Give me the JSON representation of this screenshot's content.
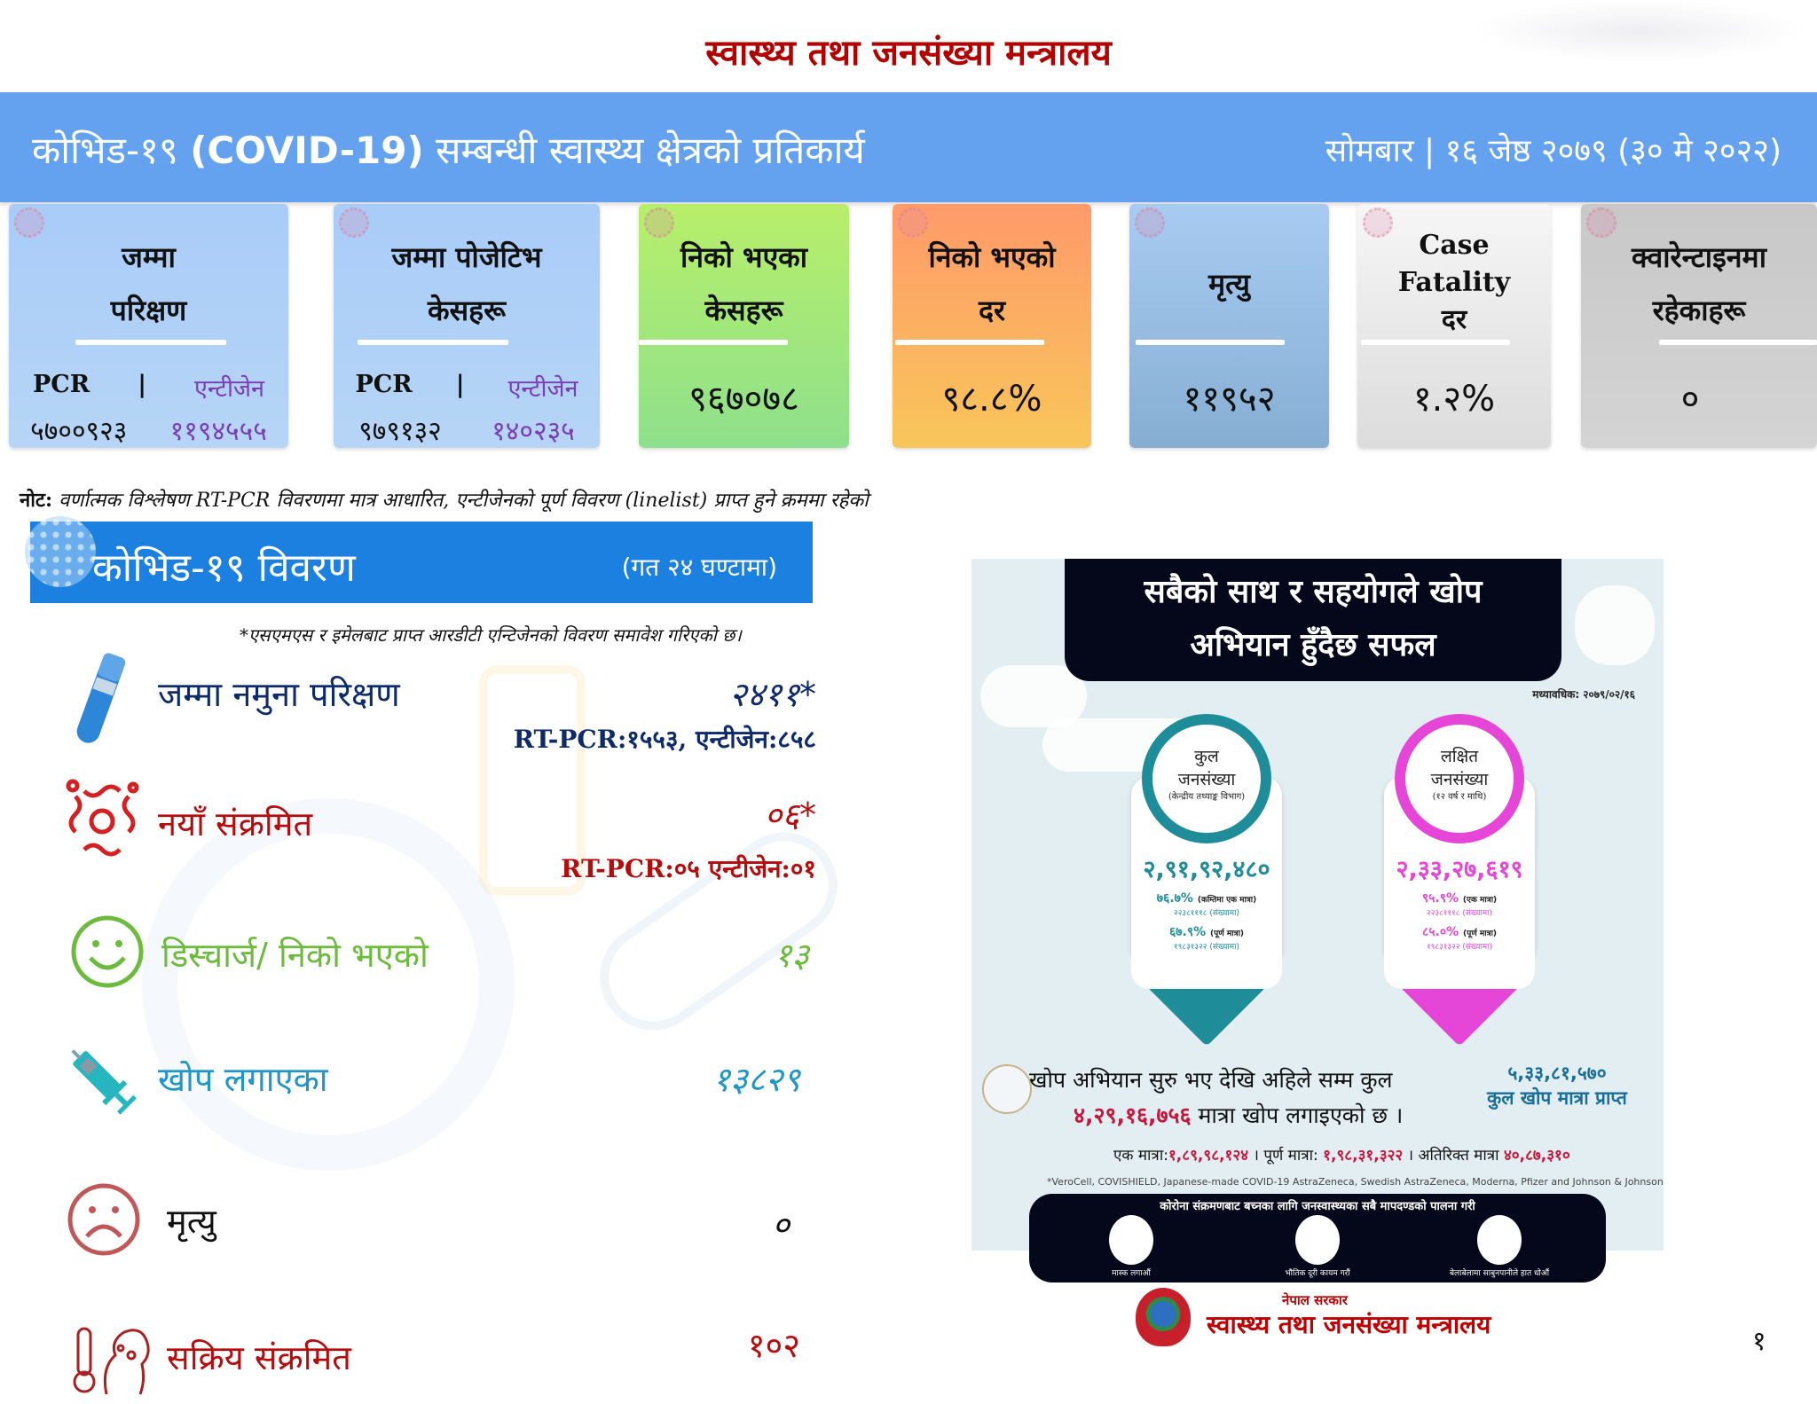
{
  "ministry_title": "स्वास्थ्य तथा जनसंख्या मन्त्रालय",
  "header": {
    "title_prefix": "कोभिड-१९",
    "title_english": "(COVID-19)",
    "title_suffix": "सम्बन्धी स्वास्थ्य क्षेत्रको प्रतिकार्य",
    "date": "सोमबार | १६ जेष्ठ २०७९ (३० मे २०२२)"
  },
  "cards": [
    {
      "title_line1": "जम्मा",
      "title_line2": "परिक्षण",
      "pcr_label": "PCR",
      "separator": "|",
      "antigen_label": "एन्टीजेन",
      "pcr_value": "५७००९२३",
      "antigen_value": "११९४५५५",
      "color_top": "#a9ccf8",
      "color_bottom": "#b6d5f6"
    },
    {
      "title_line1": "जम्मा पोजेटिभ",
      "title_line2": "केसहरू",
      "pcr_label": "PCR",
      "separator": "|",
      "antigen_label": "एन्टीजेन",
      "pcr_value": "९७९१३२",
      "antigen_value": "१४०२३५",
      "color_top": "#a9ccf8",
      "color_bottom": "#b6d5f6"
    },
    {
      "title_line1": "निको भएका",
      "title_line2": "केसहरू",
      "value": "९६७०७८",
      "color_top": "#b8ef6a",
      "color_bottom": "#8ee08c"
    },
    {
      "title_line1": "निको भएको",
      "title_line2": "दर",
      "value": "९८.८%",
      "color_top": "#ff9a6a",
      "color_bottom": "#f8c65a"
    },
    {
      "title_line1": "मृत्यु",
      "title_line2": "",
      "value": "११९५२",
      "color_top": "#a8cbf2",
      "color_bottom": "#86aed2"
    },
    {
      "title_line1": "Case",
      "title_line2": "Fatality",
      "title_line3": "दर",
      "value": "१.२%",
      "color_top": "#f6f6f6",
      "color_bottom": "#dcdcdc"
    },
    {
      "title_line1": "क्वारेन्टाइनमा",
      "title_line2": "रहेकाहरू",
      "value": "०",
      "color_top": "#c8c8c8",
      "color_bottom": "#d4d4d4"
    }
  ],
  "note": {
    "label": "नोट:",
    "text": "वर्णात्मक विश्लेषण RT-PCR  विवरणमा मात्र आधारित, एन्टीजेनको पूर्ण विवरण (linelist) प्राप्त हुने क्रममा रहेको"
  },
  "details": {
    "title": "कोभिड-१९ विवरण",
    "subtitle": "(गत २४ घण्टामा)",
    "footnote": "*एसएमएस र इमेलबाट प्राप्त आरडीटी एन्टिजेनको विवरण समावेश गरिएको छ।",
    "rows": [
      {
        "icon": "test-tube-icon",
        "label": "जम्मा नमुना परिक्षण",
        "value": "२४११*",
        "detail": "RT-PCR:१५५३, एन्टीजेन:८५८",
        "color": "#0d2a6b",
        "icon_color": "#2d86d8"
      },
      {
        "icon": "virus-icon",
        "label": "नयाँ संक्रमित",
        "value": "०६*",
        "detail": "RT-PCR:०५ एन्टीजेन:०१",
        "color": "#b50d0d",
        "icon_color": "#d42020"
      },
      {
        "icon": "smiley-icon",
        "label": "डिस्चार्ज/ निको भएको",
        "value": "१३",
        "color": "#6dbb3c",
        "icon_color": "#6dbb3c"
      },
      {
        "icon": "syringe-icon",
        "label": "खोप लगाएका",
        "value": "१३८२९",
        "color": "#1f96c8",
        "icon_color": "#26b6c0"
      },
      {
        "icon": "sad-face-icon",
        "label": "मृत्यु",
        "value": "०",
        "color": "#111111",
        "icon_color": "#c0585a"
      },
      {
        "icon": "thermometer-patient-icon",
        "label": "सक्रिय संक्रमित",
        "value": "१०२",
        "color": "#b50d0d",
        "icon_color": "#a82222"
      }
    ]
  },
  "poster": {
    "banner_line1": "सबैको साथ र सहयोगले खोप",
    "banner_line2": "अभियान हुँदैछ सफल",
    "date": "मध्यावधिक: २०७९/०२/१६",
    "total_population": {
      "title": "कुल",
      "title2": "जनसंख्या",
      "source": "(केन्द्रीय तथ्याङ्क विभाग)",
      "value": "२,९१,९२,४८०",
      "at_least_one_pct": "७६.७%",
      "at_least_one_label": "(कम्तिमा एक मात्रा)",
      "at_least_one_count": "२२३८१११८ (संख्यामा)",
      "full_pct": "६७.९%",
      "full_label": "(पूर्ण मात्रा)",
      "full_count": "१९८३१३२२ (संख्यामा)",
      "color": "#1f8c99"
    },
    "target_population": {
      "title": "लक्षित",
      "title2": "जनसंख्या",
      "source": "(१२ वर्ष र माथि)",
      "value": "२,३३,२७,६१९",
      "one_pct": "९५.९%",
      "one_label": "(एक मात्रा)",
      "one_count": "२२३८१११८ (संख्यामा)",
      "full_pct": "८५.०%",
      "full_label": "(पूर्ण मात्रा)",
      "full_count": "१९८३१३२२ (संख्यामा)",
      "color": "#e546d8"
    },
    "campaign_line1": "खोप अभियान सुरु भए देखि अहिले सम्म कुल",
    "campaign_total": "४,२९,१६,७५६",
    "campaign_line2": "मात्रा खोप लगाइएको छ ।",
    "received_value": "५,३३,८१,५७०",
    "received_label": "कुल खोप मात्रा प्राप्त",
    "dose_one_label": "एक मात्रा:",
    "dose_one_value": "१,८९,९८,१२४",
    "dose_full_label": "। पूर्ण मात्रा:",
    "dose_full_value": "१,९८,३१,३२२",
    "dose_extra_label": "। अतिरिक्त मात्रा",
    "dose_extra_value": "४०,८७,३१०",
    "brands": "*VeroCell, COVISHIELD, Japanese-made COVID-19 AstraZeneca, Swedish AstraZeneca, Moderna, Pfizer and Johnson & Johnson",
    "safety_title": "कोरोना संक्रमणबाट बच्नका लागि जनस्वास्थ्यका सबै मापदण्डको पालना गरी",
    "safety_items": [
      "मास्क लगाऔं",
      "भौतिक दूरी कायम गरौं",
      "बेलाबेलामा साबुनपानीले हात धोऔं"
    ],
    "gov_sub": "नेपाल सरकार",
    "gov_name": "स्वास्थ्य तथा जनसंख्या मन्त्रालय"
  },
  "page_number": "१"
}
